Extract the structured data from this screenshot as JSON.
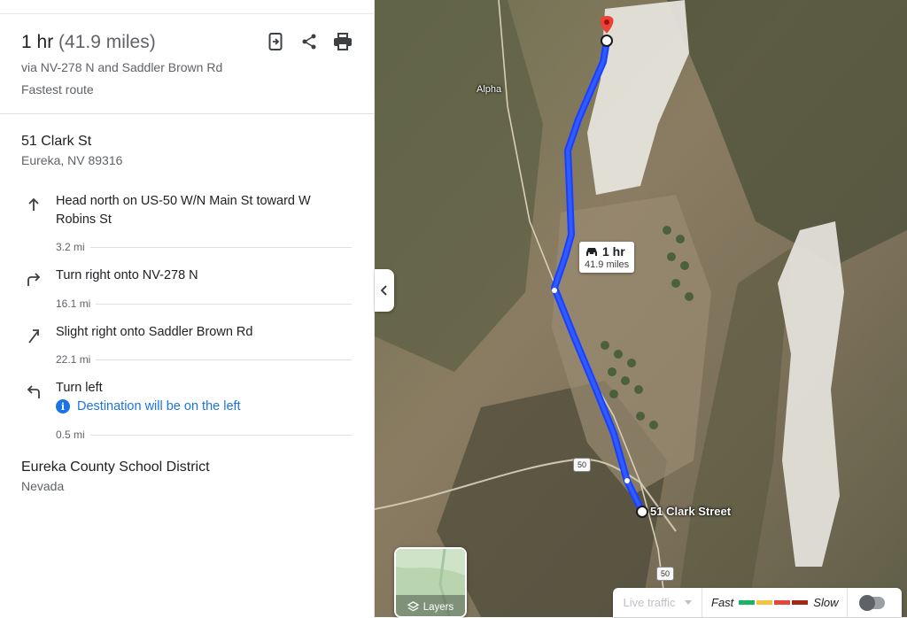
{
  "summary": {
    "duration": "1 hr",
    "distance": "(41.9 miles)",
    "via": "via NV-278 N and Saddler Brown Rd",
    "note": "Fastest route"
  },
  "start": {
    "name": "51 Clark St",
    "address": "Eureka, NV 89316"
  },
  "steps": [
    {
      "icon": "arrow-up-icon",
      "text": "Head north on US-50 W/N Main St toward W Robins St",
      "distance": "3.2 mi"
    },
    {
      "icon": "turn-right-icon",
      "text": "Turn right onto NV-278 N",
      "distance": "16.1 mi"
    },
    {
      "icon": "slight-right-icon",
      "text": "Slight right onto Saddler Brown Rd",
      "distance": "22.1 mi"
    },
    {
      "icon": "turn-left-icon",
      "text": "Turn left",
      "note": "Destination will be on the left",
      "distance": "0.5 mi"
    }
  ],
  "destination": {
    "name": "Eureka County School District",
    "region": "Nevada"
  },
  "map": {
    "route_time": "1 hr",
    "route_distance": "41.9 miles",
    "start_label": "51 Clark Street",
    "place_label": "Alpha",
    "shield_1": "50",
    "shield_2": "50",
    "route_color": "#1a3fff"
  },
  "controls": {
    "layers_label": "Layers",
    "traffic_select": "Live traffic",
    "legend_fast": "Fast",
    "legend_slow": "Slow",
    "legend_colors": [
      "#1db366",
      "#f5c342",
      "#e8453c",
      "#a52714"
    ]
  }
}
